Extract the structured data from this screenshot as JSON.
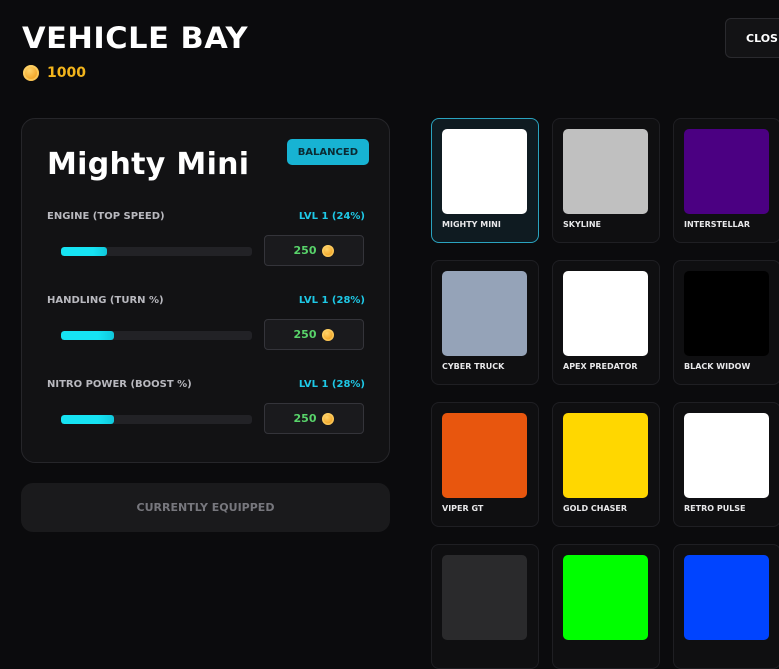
{
  "header": {
    "title": "VEHICLE BAY",
    "coins": "1000",
    "close_label": "CLOSE"
  },
  "selected_car": {
    "name": "Mighty Mini",
    "badge": "BALANCED",
    "stats": [
      {
        "label": "ENGINE (TOP SPEED)",
        "level": "LVL 1 (24%)",
        "progress": 0.24,
        "cost": "250"
      },
      {
        "label": "HANDLING (TURN %)",
        "level": "LVL 1 (28%)",
        "progress": 0.28,
        "cost": "250"
      },
      {
        "label": "NITRO POWER (BOOST %)",
        "level": "LVL 1 (28%)",
        "progress": 0.28,
        "cost": "250"
      }
    ],
    "equip_status": "CURRENTLY EQUIPPED"
  },
  "cars": [
    {
      "name": "MIGHTY MINI",
      "color": "#ffffff",
      "selected": true
    },
    {
      "name": "SKYLINE",
      "color": "#c0c0c0",
      "selected": false
    },
    {
      "name": "INTERSTELLAR",
      "color": "#4b0082",
      "selected": false
    },
    {
      "name": "CYBER TRUCK",
      "color": "#95a3b8",
      "selected": false
    },
    {
      "name": "APEX PREDATOR",
      "color": "#ffffff",
      "selected": false
    },
    {
      "name": "BLACK WIDOW",
      "color": "#000000",
      "selected": false
    },
    {
      "name": "VIPER GT",
      "color": "#e8560e",
      "selected": false
    },
    {
      "name": "GOLD CHASER",
      "color": "#ffd700",
      "selected": false
    },
    {
      "name": "RETRO PULSE",
      "color": "#ffffff",
      "selected": false
    },
    {
      "name": "",
      "color": "#2a2a2c",
      "selected": false
    },
    {
      "name": "",
      "color": "#00ff00",
      "selected": false
    },
    {
      "name": "",
      "color": "#0044ff",
      "selected": false
    }
  ]
}
